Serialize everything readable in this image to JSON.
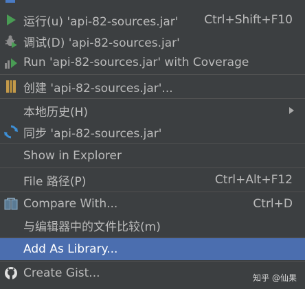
{
  "menu": {
    "items": [
      {
        "id": "run",
        "label": "运行(u) 'api-82-sources.jar'",
        "shortcut": "Ctrl+Shift+F10",
        "icon": "run-icon"
      },
      {
        "id": "debug",
        "label": "调试(D) 'api-82-sources.jar'",
        "shortcut": "",
        "icon": "debug-icon"
      },
      {
        "id": "coverage",
        "label": "Run 'api-82-sources.jar' with Coverage",
        "shortcut": "",
        "icon": "coverage-icon"
      },
      {
        "id": "create",
        "label": "创建 'api-82-sources.jar'...",
        "shortcut": "",
        "icon": "create-config-icon"
      },
      {
        "id": "history",
        "label": "本地历史(H)",
        "shortcut": "",
        "icon": "",
        "submenu": true
      },
      {
        "id": "sync",
        "label": "同步 'api-82-sources.jar'",
        "shortcut": "",
        "icon": "sync-icon"
      },
      {
        "id": "explorer",
        "label": "Show in Explorer",
        "shortcut": "",
        "icon": ""
      },
      {
        "id": "filepath",
        "label": "File 路径(P)",
        "shortcut": "Ctrl+Alt+F12",
        "icon": ""
      },
      {
        "id": "compare",
        "label": "Compare With...",
        "shortcut": "Ctrl+D",
        "icon": "compare-icon"
      },
      {
        "id": "compare-editor",
        "label": "与编辑器中的文件比较(m)",
        "shortcut": "",
        "icon": ""
      },
      {
        "id": "library",
        "label": "Add As Library...",
        "shortcut": "",
        "icon": "",
        "selected": true
      },
      {
        "id": "gist",
        "label": "Create Gist...",
        "shortcut": "",
        "icon": "github-icon"
      }
    ]
  },
  "watermark": "知乎 @仙果",
  "colors": {
    "background": "#3c3f41",
    "selected": "#4b6eaf",
    "text": "#bbbbbb",
    "separator": "#515151",
    "run_green": "#499c54",
    "sync_blue": "#3d8fd6"
  }
}
